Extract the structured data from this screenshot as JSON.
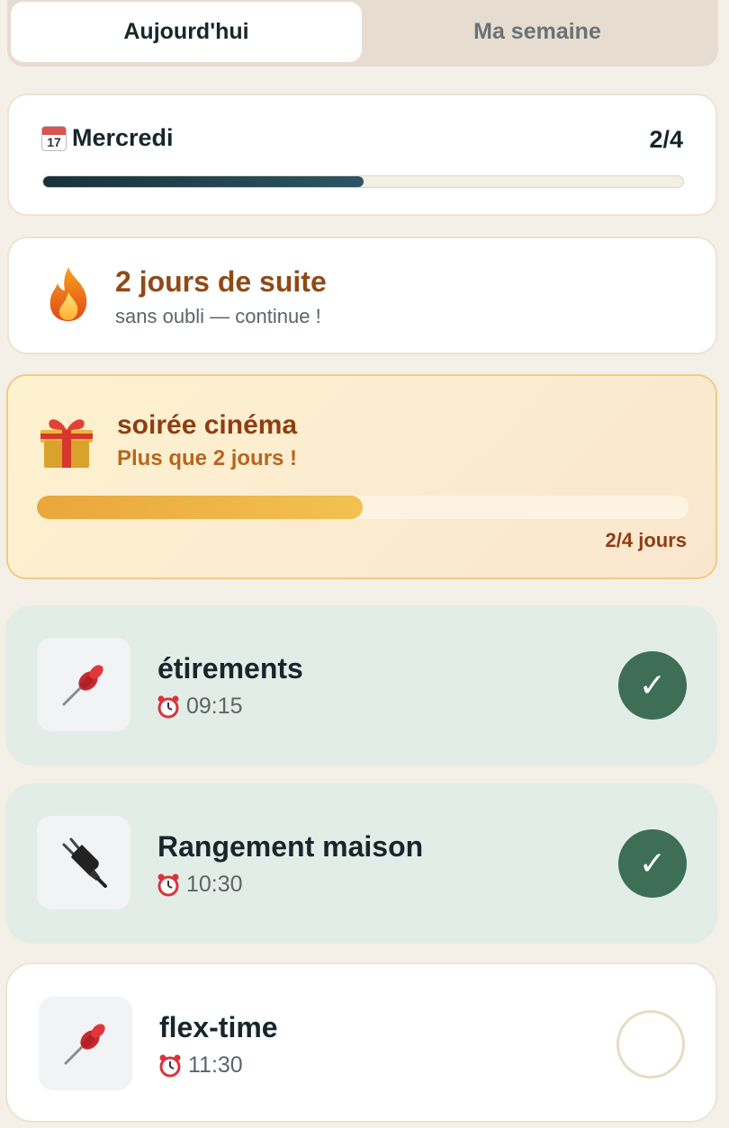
{
  "tabs": [
    {
      "label": "Aujourd'hui",
      "active": true
    },
    {
      "label": "Ma semaine",
      "active": false
    }
  ],
  "day": {
    "icon": "calendar-icon",
    "icon_number": "17",
    "name": "Mercredi",
    "count": "2/4",
    "progress": 0.5
  },
  "streak": {
    "icon": "flame-icon",
    "title": "2 jours de suite",
    "subtitle": "sans oubli — continue !"
  },
  "reward": {
    "icon": "gift-icon",
    "title": "soirée cinéma",
    "subtitle": "Plus que 2 jours !",
    "progress": 0.5,
    "count": "2/4 jours"
  },
  "tasks": [
    {
      "title": "étirements",
      "time": "09:15",
      "icon": "pushpin-icon",
      "done": true
    },
    {
      "title": "Rangement maison",
      "time": "10:30",
      "icon": "plug-icon",
      "done": true
    },
    {
      "title": "flex-time",
      "time": "11:30",
      "icon": "pushpin-icon",
      "done": false
    }
  ],
  "check_glyph": "✓",
  "colors": {
    "background": "#f4efe7",
    "primary_dark": "#17262b",
    "streak_brown": "#8f4a17",
    "reward_orange": "#eaa63c",
    "done_green": "#3e6e56",
    "done_bg": "#e3ede7"
  }
}
